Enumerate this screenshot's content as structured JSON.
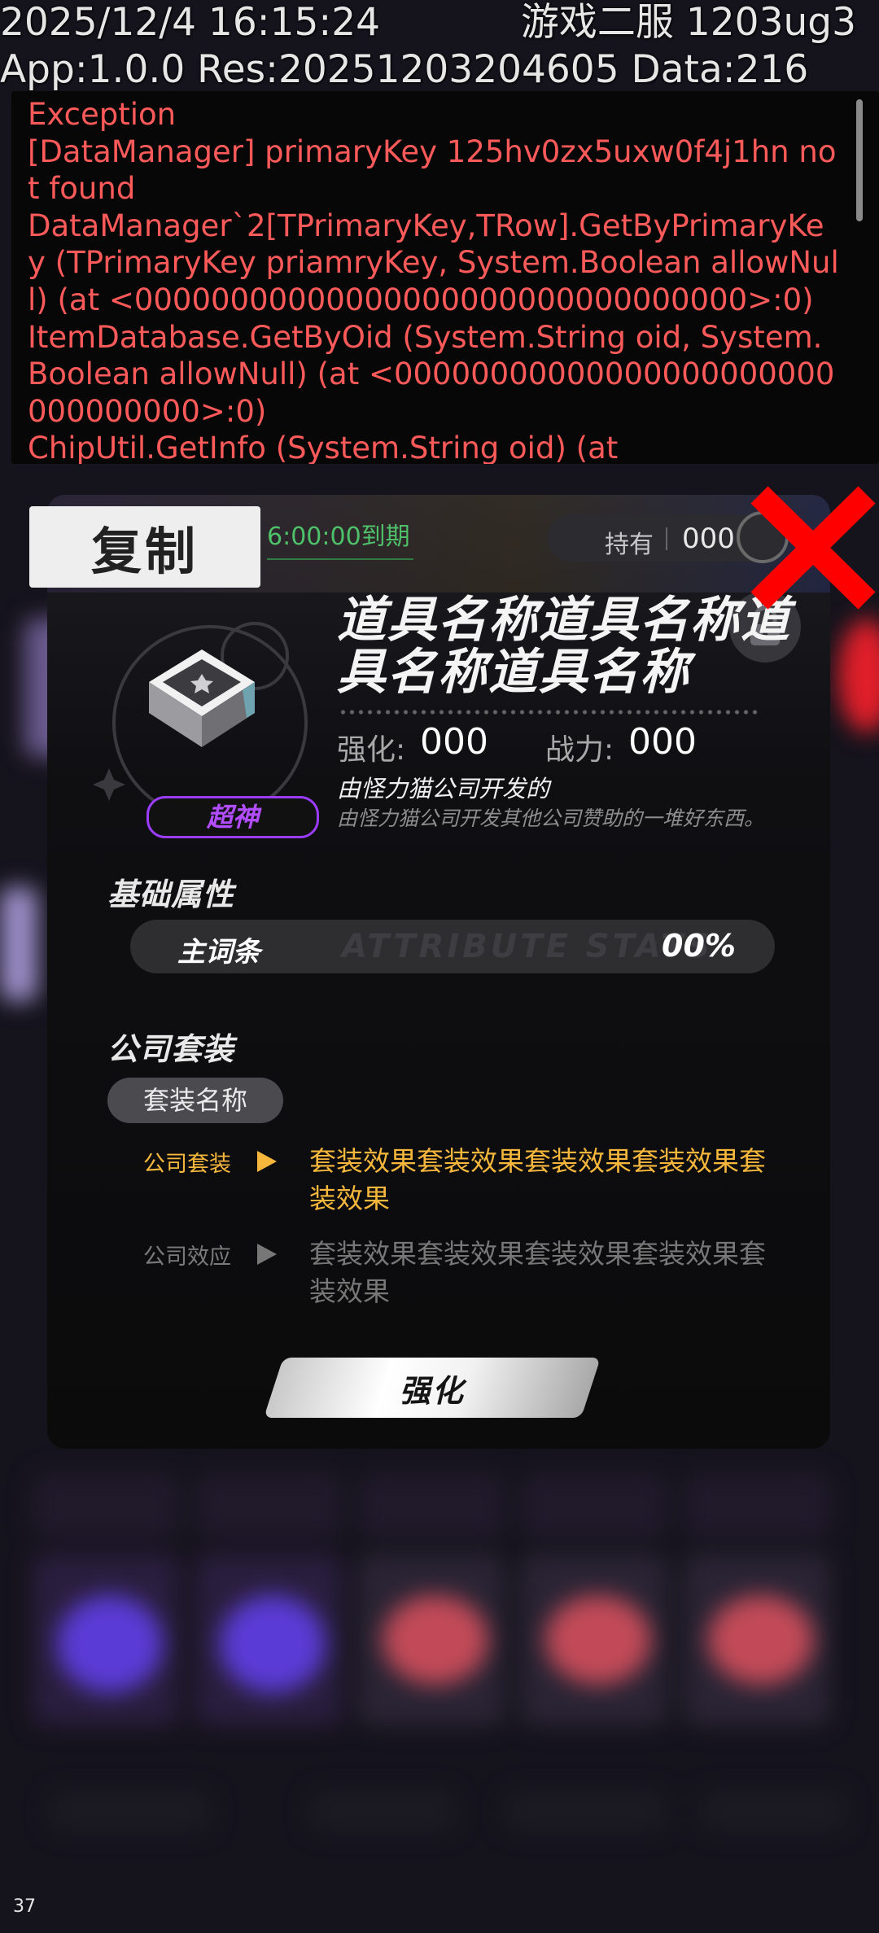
{
  "debug": {
    "datetime": "2025/12/4 16:15:24",
    "server": "游戏二服 1203ug3",
    "version": "App:1.0.0 Res:20251203204605 Data:216"
  },
  "console": {
    "text": "Exception\n[DataManager] primaryKey 125hv0zx5uxw0f4j1hn not found\nDataManager`2[TPrimaryKey,TRow].GetByPrimaryKey (TPrimaryKey priamryKey, System.Boolean allowNull) (at <00000000000000000000000000000000>:0)\nItemDatabase.GetByOid (System.String oid, System.Boolean allowNull) (at <00000000000000000000000000000000>:0)\nChipUtil.GetInfo (System.String oid) (at"
  },
  "copy_button": {
    "label": "复制"
  },
  "item": {
    "expire": "6:00:00到期",
    "hold_label": "持有",
    "hold_value": "000",
    "name": "道具名称道具名称道具名称道具名称",
    "rarity": "超神",
    "strength_label": "强化:",
    "strength_value": "000",
    "power_label": "战力:",
    "power_value": "000",
    "origin": "由怪力猫公司开发的",
    "description": "由怪力猫公司开发其他公司赞助的一堆好东西。"
  },
  "basic": {
    "title": "基础属性",
    "main_label": "主词条",
    "main_value": "00%"
  },
  "suit": {
    "title": "公司套装",
    "name": "套装名称",
    "effects": [
      {
        "label": "公司套装",
        "text": "套装效果套装效果套装效果套装效果套装效果",
        "color": "#f6b73c"
      },
      {
        "label": "公司效应",
        "text": "套装效果套装效果套装效果套装效果套装效果",
        "color": "#777777"
      }
    ]
  },
  "enhance_button": {
    "label": "强化"
  },
  "fps": "37",
  "icons": [
    "lock-icon",
    "close-icon",
    "chip-item-icon"
  ],
  "colors": {
    "console_text": "#ff5a5a",
    "rarity": "#9b3cff",
    "expire": "#4fc06a",
    "close": "#ff0000"
  }
}
